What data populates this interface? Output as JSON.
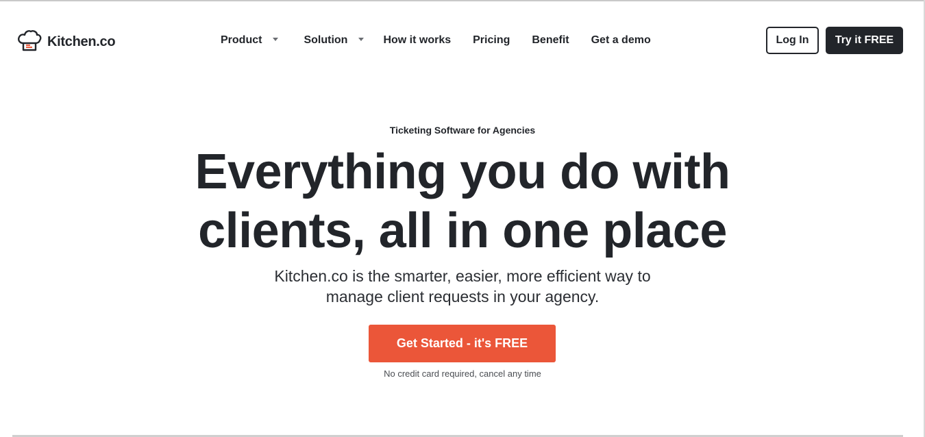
{
  "brand": {
    "name": "Kitchen.co",
    "icon": "chef-hat-icon",
    "accent_color": "#eb5639",
    "dark_color": "#22252a"
  },
  "nav": {
    "items": [
      {
        "label": "Product",
        "has_dropdown": true
      },
      {
        "label": "Solution",
        "has_dropdown": true
      },
      {
        "label": "How it works",
        "has_dropdown": false
      },
      {
        "label": "Pricing",
        "has_dropdown": false
      },
      {
        "label": "Benefit",
        "has_dropdown": false
      },
      {
        "label": "Get a demo",
        "has_dropdown": false
      }
    ],
    "login_label": "Log In",
    "try_label": "Try it FREE"
  },
  "hero": {
    "eyebrow": "Ticketing Software for Agencies",
    "headline_line1": "Everything you do with",
    "headline_line2": "clients, all in one place",
    "subhead_line1": "Kitchen.co is the smarter, easier, more efficient way to",
    "subhead_line2": "manage client requests in your agency.",
    "cta_label": "Get Started - it's FREE",
    "note": "No credit card required, cancel any time"
  }
}
